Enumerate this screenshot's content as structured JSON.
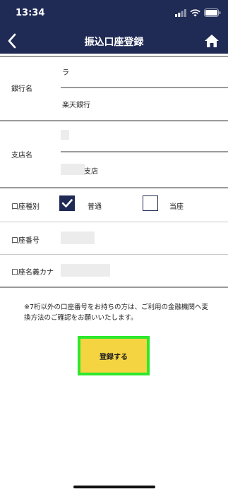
{
  "status": {
    "time": "13:34"
  },
  "header": {
    "title": "振込口座登録"
  },
  "form": {
    "bank": {
      "label": "銀行名",
      "kana_value": "ラ",
      "value": "楽天銀行"
    },
    "branch": {
      "label": "支店名",
      "value_suffix": "支店"
    },
    "account_type": {
      "label": "口座種別",
      "options": [
        {
          "label": "普通",
          "checked": true
        },
        {
          "label": "当座",
          "checked": false
        }
      ]
    },
    "account_number": {
      "label": "口座番号"
    },
    "account_name_kana": {
      "label": "口座名義カナ"
    }
  },
  "note": "※7桁以外の口座番号をお持ちの方は、ご利用の金融機関へ変換方法のご確認をお願いいたします。",
  "register_button": {
    "label": "登録する"
  },
  "colors": {
    "nav": "#1f2a55",
    "button": "#f5d442",
    "button_border": "#2de82d"
  }
}
